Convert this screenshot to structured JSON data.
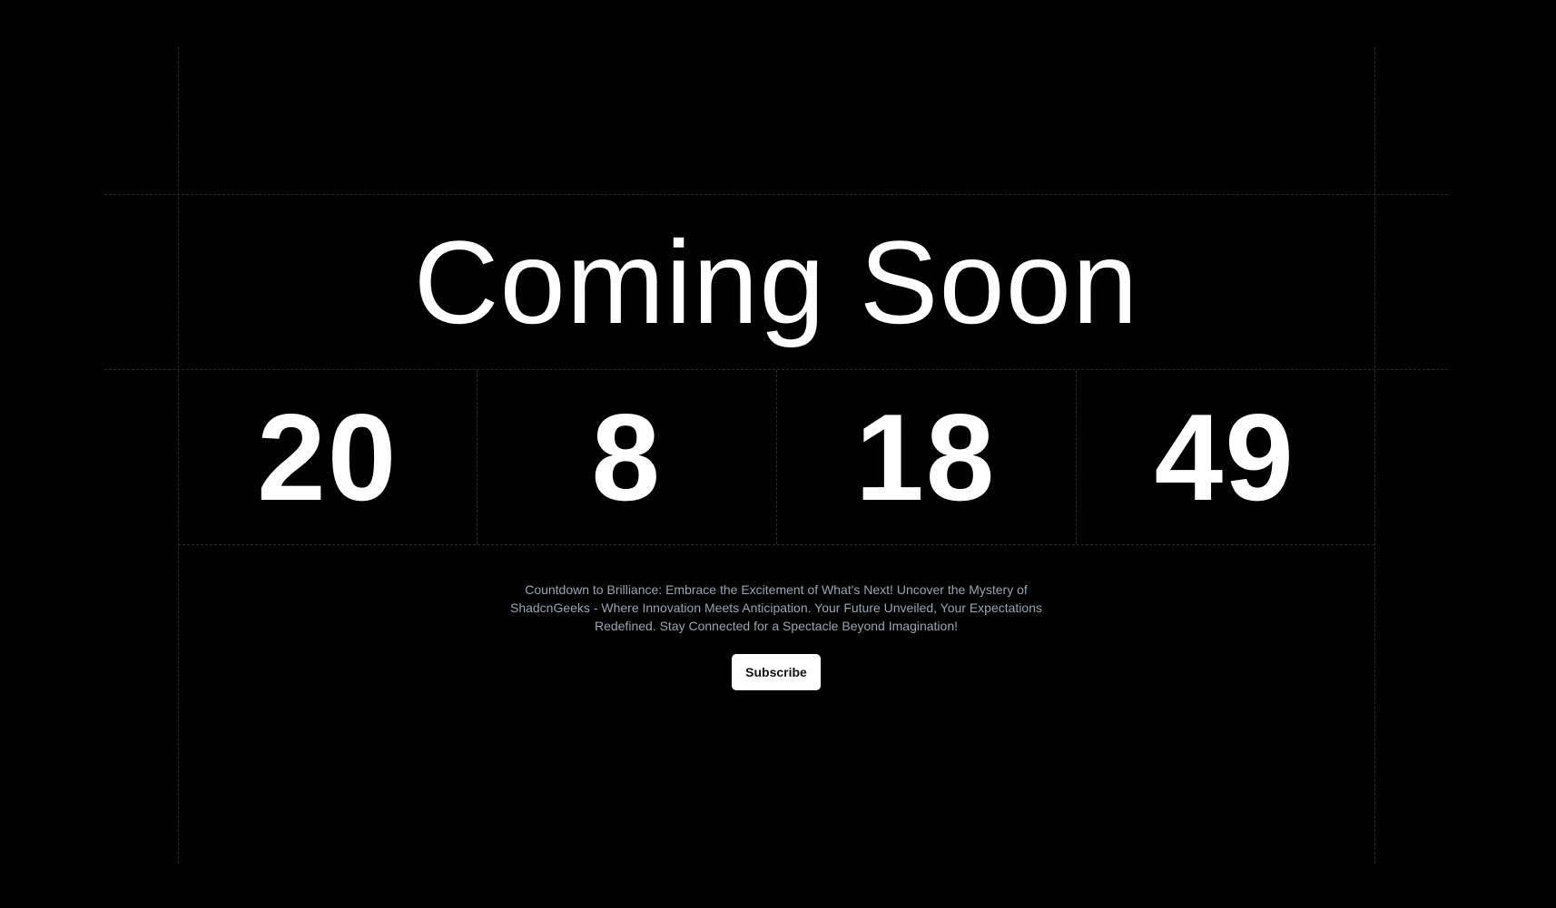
{
  "hero": {
    "title": "Coming Soon"
  },
  "countdown": {
    "values": [
      "20",
      "8",
      "18",
      "49"
    ]
  },
  "description": "Countdown to Brilliance: Embrace the Excitement of What's Next! Uncover the Mystery of ShadcnGeeks - Where Innovation Meets Anticipation. Your Future Unveiled, Your Expectations Redefined. Stay Connected for a Spectacle Beyond Imagination!",
  "actions": {
    "subscribe_label": "Subscribe"
  },
  "colors": {
    "background": "#000000",
    "text": "#ffffff",
    "muted_text": "#9aa4b2",
    "grid_line": "#2a2a2a",
    "button_bg": "#ffffff",
    "button_text": "#111111"
  }
}
